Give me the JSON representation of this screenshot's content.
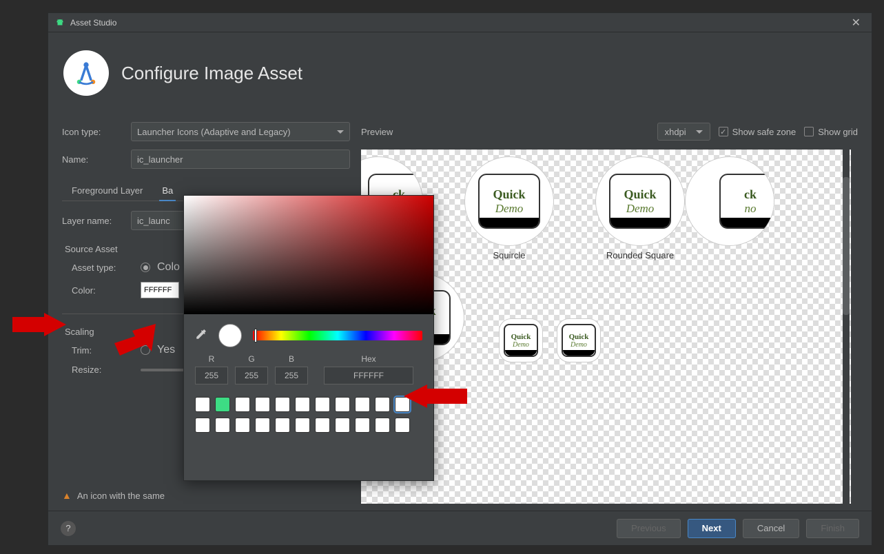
{
  "window": {
    "title": "Asset Studio"
  },
  "header": {
    "title": "Configure Image Asset"
  },
  "form": {
    "iconType": {
      "label": "Icon type:",
      "value": "Launcher Icons (Adaptive and Legacy)"
    },
    "name": {
      "label": "Name:",
      "value": "ic_launcher"
    },
    "tabs": {
      "foreground": "Foreground Layer",
      "background": "Ba"
    },
    "layerName": {
      "label": "Layer name:",
      "value": "ic_launc"
    },
    "sourceAsset": {
      "title": "Source Asset",
      "assetTypeLabel": "Asset type:",
      "assetTypeValue": "Colo",
      "colorLabel": "Color:",
      "colorValue": "FFFFFF"
    },
    "scaling": {
      "title": "Scaling",
      "trimLabel": "Trim:",
      "trimValue": "Yes",
      "resizeLabel": "Resize:"
    },
    "warning": "An icon with the same"
  },
  "preview": {
    "label": "Preview",
    "density": "xhdpi",
    "safeZone": "Show safe zone",
    "showGrid": "Show grid",
    "captions": {
      "squircle": "Squircle",
      "rounded": "Rounded Square"
    },
    "logo": {
      "line1": "Quick",
      "line2": "Demo"
    }
  },
  "colorpicker": {
    "r": {
      "label": "R",
      "value": "255"
    },
    "g": {
      "label": "G",
      "value": "255"
    },
    "b": {
      "label": "B",
      "value": "255"
    },
    "hex": {
      "label": "Hex",
      "value": "FFFFFF"
    }
  },
  "footer": {
    "help": "?",
    "previous": "Previous",
    "next": "Next",
    "cancel": "Cancel",
    "finish": "Finish"
  }
}
